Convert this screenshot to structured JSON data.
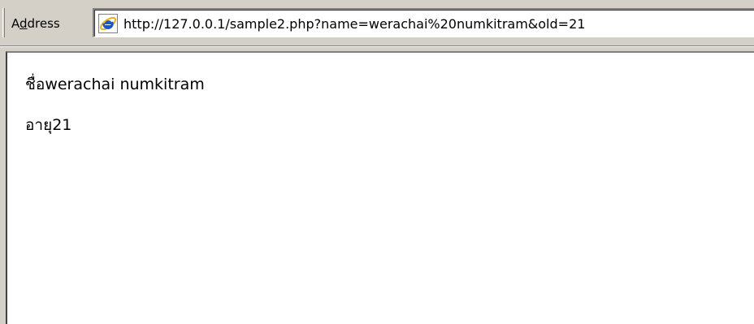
{
  "address_bar": {
    "label_prefix": "A",
    "label_accel": "d",
    "label_suffix": "dress",
    "url": "http://127.0.0.1/sample2.php?name=werachai%20numkitram&old=21",
    "icon": "ie-page-icon"
  },
  "page": {
    "name_label": "ชื่อ",
    "name_value": "werachai numkitram",
    "age_label": "อายุ",
    "age_value": "21"
  },
  "colors": {
    "chrome": "#d4d0c8",
    "page_background": "#ffffff",
    "ie_blue": "#1a57c8",
    "ie_gold": "#e8b11c"
  }
}
